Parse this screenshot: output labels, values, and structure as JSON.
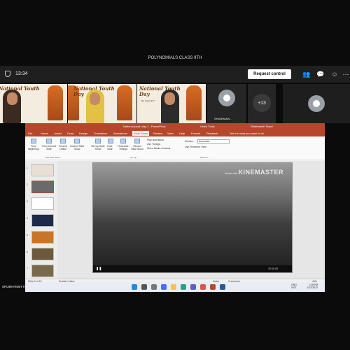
{
  "meeting": {
    "title": "POLYNOMIALS CLASS 9TH",
    "timer": "13:34",
    "request_control": "Request control"
  },
  "participants": {
    "tile_title_1": "National Youth",
    "tile_title_2": "Day",
    "tile_sub": "By: Class 9\"C\"",
    "shubhansh_short": "SHUBHANS...",
    "more_count": "+13"
  },
  "ppt": {
    "doc_title": "National youth day 1 - PowerPoint",
    "video_tools": "Video Tools",
    "user": "Shubhansh Tiwari",
    "tabs": [
      "File",
      "Home",
      "Insert",
      "Draw",
      "Design",
      "Transitions",
      "Animations",
      "Slide Show",
      "Review",
      "View",
      "Help",
      "Format",
      "Playback",
      "Tell me what you want to do"
    ],
    "ribbon": {
      "from_beginning": "From Beginning",
      "from_current": "From Current Slide",
      "present_online": "Present Online",
      "custom_show": "Custom Slide Show",
      "start_group": "Start Slide Show",
      "setup_show": "Set Up Slide Show",
      "hide_slide": "Hide Slide",
      "rehearse": "Rehearse Timings",
      "record": "Record Slide Show",
      "play_narrations": "Play Narrations",
      "use_timings": "Use Timings",
      "show_media": "Show Media Controls",
      "setup_group": "Set Up",
      "monitor_label": "Monitor:",
      "monitor_value": "Automatic",
      "use_presenter": "Use Presenter View",
      "monitors_group": "Monitors"
    },
    "thumb_numbers": [
      "1",
      "2",
      "3",
      "4",
      "5",
      "6",
      "7"
    ],
    "watermark_small": "Made with",
    "watermark_big": "KINEMASTER",
    "video_time": "00:15.83",
    "status_slide": "Slide 2 of 15",
    "status_lang": "English (India)",
    "status_notes": "Notes",
    "status_comments": "Comments",
    "zoom": "46%"
  },
  "presenter": "SHUBHANSH TIWARI",
  "taskbar": {
    "lang_1": "ENG",
    "lang_2": "INTL",
    "time": "1:25 PM",
    "date": "1/12/2022"
  },
  "colors": {
    "ppt_accent": "#b7472a",
    "teams_bg": "#0b0b0b"
  }
}
